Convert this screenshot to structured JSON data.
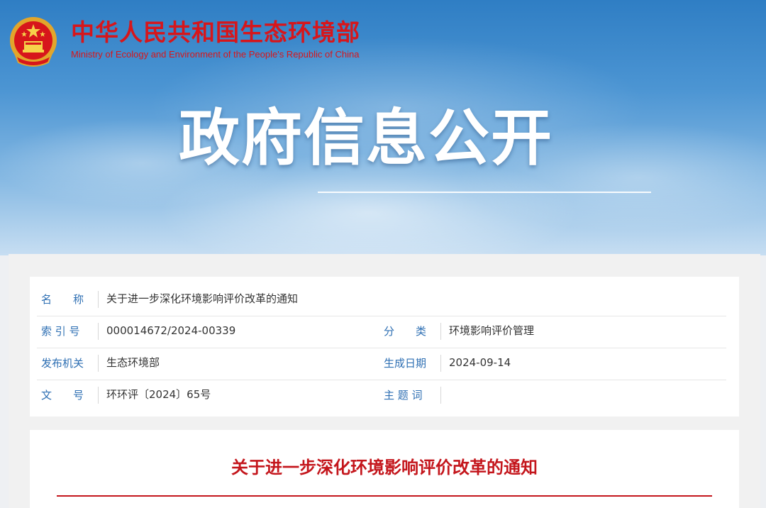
{
  "header": {
    "site_name_cn": "中华人民共和国生态环境部",
    "site_name_en": "Ministry of Ecology and Environment of the People's Republic of China",
    "emblem_icon": "national-emblem-icon"
  },
  "banner": {
    "title": "政府信息公开"
  },
  "meta": {
    "name_label": "名　　称",
    "name_value": "关于进一步深化环境影响评价改革的通知",
    "index_label": "索 引 号",
    "index_value": "000014672/2024-00339",
    "category_label": "分　　类",
    "category_value": "环境影响评价管理",
    "publisher_label": "发布机关",
    "publisher_value": "生态环境部",
    "date_label": "生成日期",
    "date_value": "2024-09-14",
    "docno_label": "文　　号",
    "docno_value": "环环评〔2024〕65号",
    "keywords_label": "主 题 词",
    "keywords_value": ""
  },
  "document": {
    "title": "关于进一步深化环境影响评价改革的通知"
  },
  "colors": {
    "brand_red": "#d7161b",
    "label_blue": "#2e6fb3",
    "title_red": "#c4161c"
  }
}
